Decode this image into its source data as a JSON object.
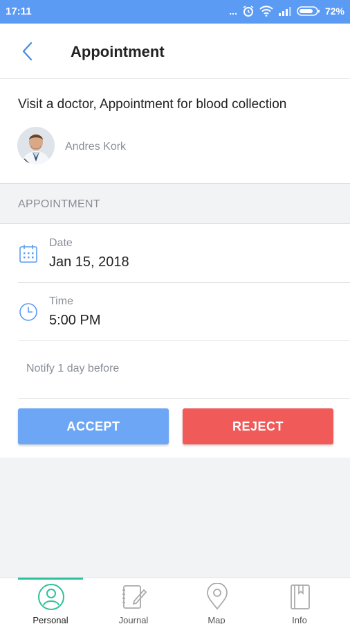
{
  "status_bar": {
    "time": "17:11",
    "dots": "...",
    "battery_percent": "72%",
    "icons": [
      "alarm-icon",
      "wifi-icon",
      "signal-icon",
      "battery-icon"
    ]
  },
  "header": {
    "title": "Appointment",
    "back_icon": "chevron-left-icon"
  },
  "appointment": {
    "title": "Visit a doctor, Appointment for blood collection",
    "doctor_name": "Andres Kork"
  },
  "section": {
    "label": "APPOINTMENT"
  },
  "details": {
    "date_label": "Date",
    "date_value": "Jan 15, 2018",
    "time_label": "Time",
    "time_value": "5:00 PM",
    "notify": "Notify 1 day before"
  },
  "actions": {
    "accept_label": "ACCEPT",
    "reject_label": "REJECT"
  },
  "tabs": [
    {
      "label": "Personal",
      "icon": "person-icon",
      "active": true
    },
    {
      "label": "Journal",
      "icon": "journal-icon",
      "active": false
    },
    {
      "label": "Map",
      "icon": "map-pin-icon",
      "active": false
    },
    {
      "label": "Info",
      "icon": "book-icon",
      "active": false
    }
  ],
  "colors": {
    "status_bar": "#5b9bf3",
    "accent_blue": "#4a90e2",
    "accept": "#6ea6f6",
    "reject": "#f05a58",
    "active_tab": "#2ec09a"
  }
}
